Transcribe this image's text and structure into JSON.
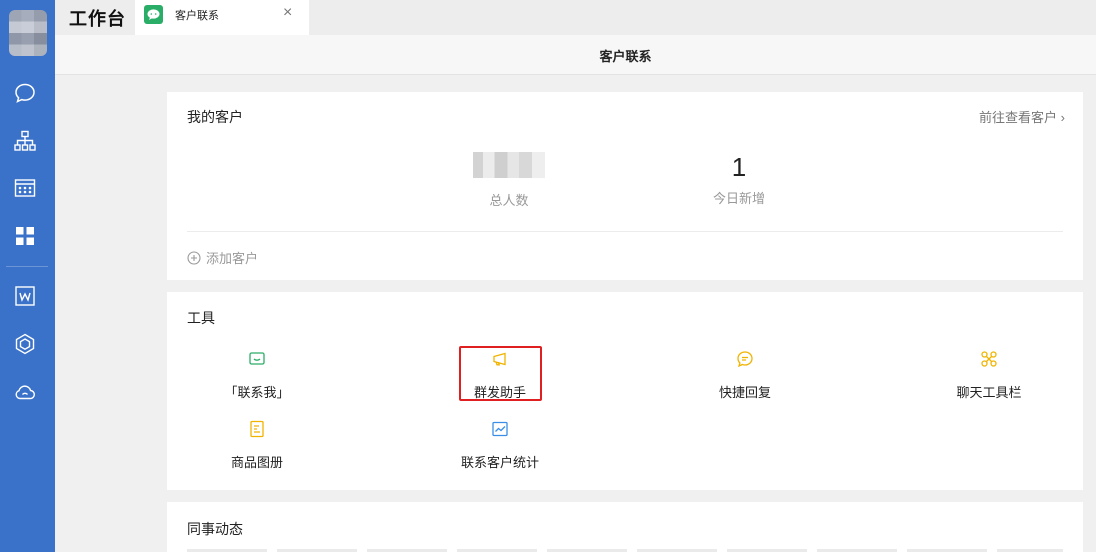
{
  "app": {
    "title": "工作台"
  },
  "tab": {
    "label": "客户联系",
    "close": "×"
  },
  "header": {
    "title": "客户联系"
  },
  "sidebar": {
    "icons": [
      "chat-icon",
      "org-chart-icon",
      "calendar-icon",
      "workbench-grid-icon",
      "document-w-icon",
      "cube-icon",
      "cloud-icon"
    ]
  },
  "my_customers": {
    "title": "我的客户",
    "goto_link": "前往查看客户 ›",
    "total_label": "总人数",
    "new_today_value": "1",
    "new_today_label": "今日新增",
    "add_customer": "添加客户"
  },
  "tools": {
    "title": "工具",
    "items": [
      {
        "label": "「联系我」",
        "icon": "contact-me-icon",
        "color": "#2aae67"
      },
      {
        "label": "群发助手",
        "icon": "megaphone-icon",
        "color": "#f0b400"
      },
      {
        "label": "快捷回复",
        "icon": "quick-reply-icon",
        "color": "#f0b400"
      },
      {
        "label": "聊天工具栏",
        "icon": "chat-toolbar-icon",
        "color": "#f0b400"
      },
      {
        "label": "商品图册",
        "icon": "product-album-icon",
        "color": "#f0b400"
      },
      {
        "label": "联系客户统计",
        "icon": "statistics-icon",
        "color": "#3a8ee6"
      }
    ],
    "highlighted": "群发助手"
  },
  "colleague_updates": {
    "title": "同事动态"
  },
  "colors": {
    "sidebar": "#3a72c9",
    "highlight": "#e02020",
    "accent_green": "#2aae67"
  }
}
